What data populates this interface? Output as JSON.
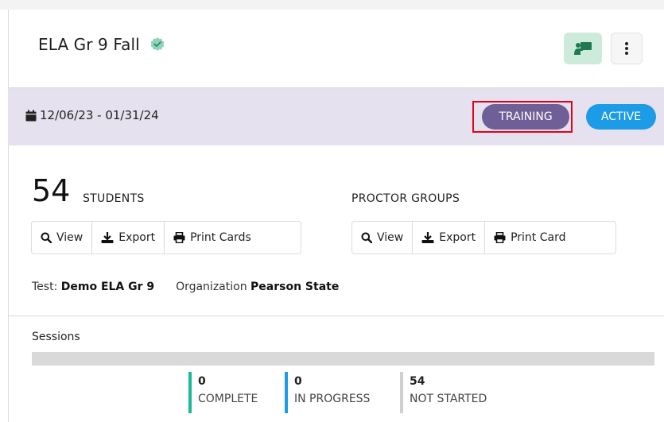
{
  "header": {
    "title": "ELA Gr 9 Fall",
    "icons": {
      "verified": "verified-badge-icon",
      "classroom": "classroom-presenter-icon",
      "more": "kebab-menu-icon"
    }
  },
  "date_band": {
    "date_range": "12/06/23 - 01/31/24",
    "calendar_icon": "calendar-icon",
    "badges": {
      "training": "TRAINING",
      "active": "ACTIVE"
    },
    "colors": {
      "band_bg": "#e5e1ee",
      "training": "#6e5f96",
      "active": "#1c9be6"
    }
  },
  "students": {
    "count": "54",
    "label": "STUDENTS",
    "actions": [
      {
        "label": "View",
        "icon": "search-icon"
      },
      {
        "label": "Export",
        "icon": "download-icon"
      },
      {
        "label": "Print Cards",
        "icon": "print-icon"
      }
    ]
  },
  "proctor_groups": {
    "label": "PROCTOR GROUPS",
    "actions": [
      {
        "label": "View",
        "icon": "search-icon"
      },
      {
        "label": "Export",
        "icon": "download-icon"
      },
      {
        "label": "Print Card",
        "icon": "print-icon"
      }
    ]
  },
  "info": {
    "test_label": "Test:",
    "test_value": "Demo ELA Gr 9",
    "org_label": "Organization",
    "org_value": "Pearson State"
  },
  "sessions": {
    "label": "Sessions",
    "stats": [
      {
        "value": "0",
        "label": "COMPLETE",
        "color": "#1db89a"
      },
      {
        "value": "0",
        "label": "IN PROGRESS",
        "color": "#1c9be6"
      },
      {
        "value": "54",
        "label": "NOT STARTED",
        "color": "#d0d0d0"
      }
    ]
  }
}
